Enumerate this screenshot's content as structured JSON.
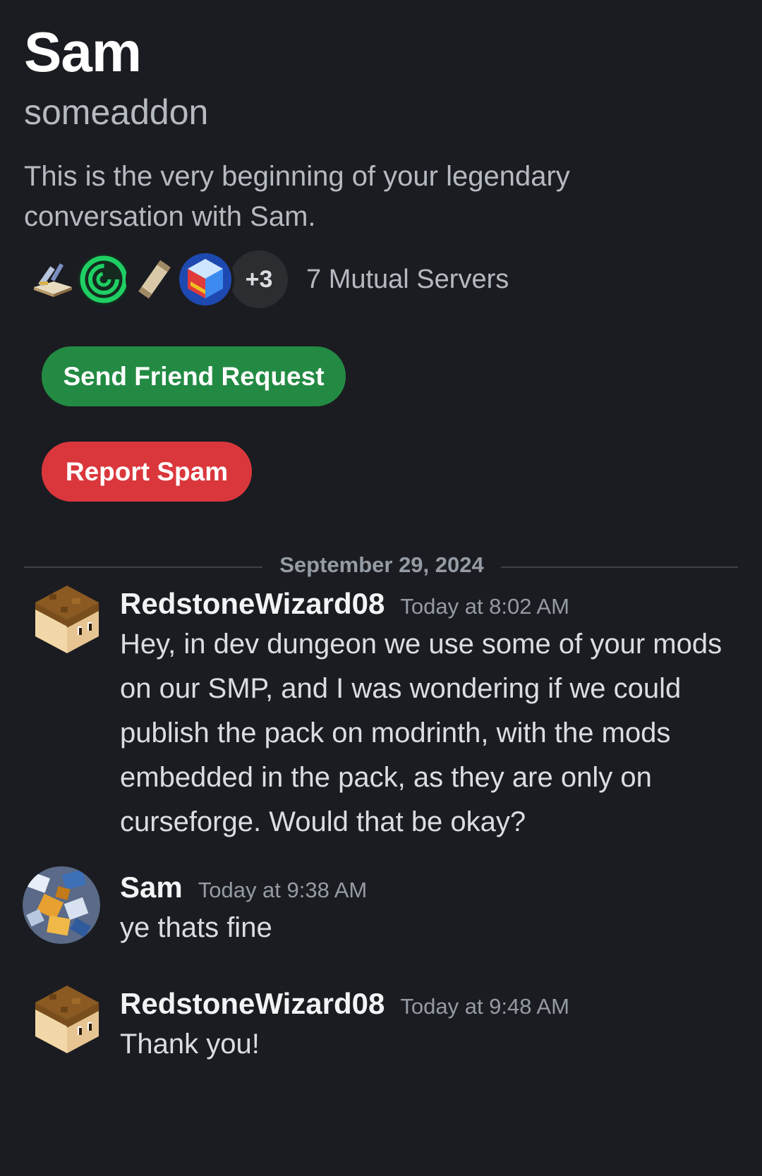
{
  "profile": {
    "display_name": "Sam",
    "username": "someaddon",
    "intro": "This is the very beginning of your legendary conversation with Sam.",
    "mutual_more": "+3",
    "mutual_servers": "7 Mutual Servers"
  },
  "actions": {
    "friend_label": "Send Friend Request",
    "spam_label": "Report Spam"
  },
  "date_divider": "September 29, 2024",
  "messages": [
    {
      "author": "RedstoneWizard08",
      "time": "Today at 8:02 AM",
      "text": "Hey, in dev dungeon we use some of your mods on our SMP, and I was wondering if we could publish the pack on modrinth, with the mods embedded in the pack, as they are only on curseforge. Would that be okay?"
    },
    {
      "author": "Sam",
      "time": "Today at 9:38 AM",
      "text": "ye thats fine"
    },
    {
      "author": "RedstoneWizard08",
      "time": "Today at 9:48 AM",
      "text": "Thank you!"
    }
  ],
  "colors": {
    "background": "#1b1c21",
    "friend_button": "#238a43",
    "spam_button": "#da373c"
  }
}
